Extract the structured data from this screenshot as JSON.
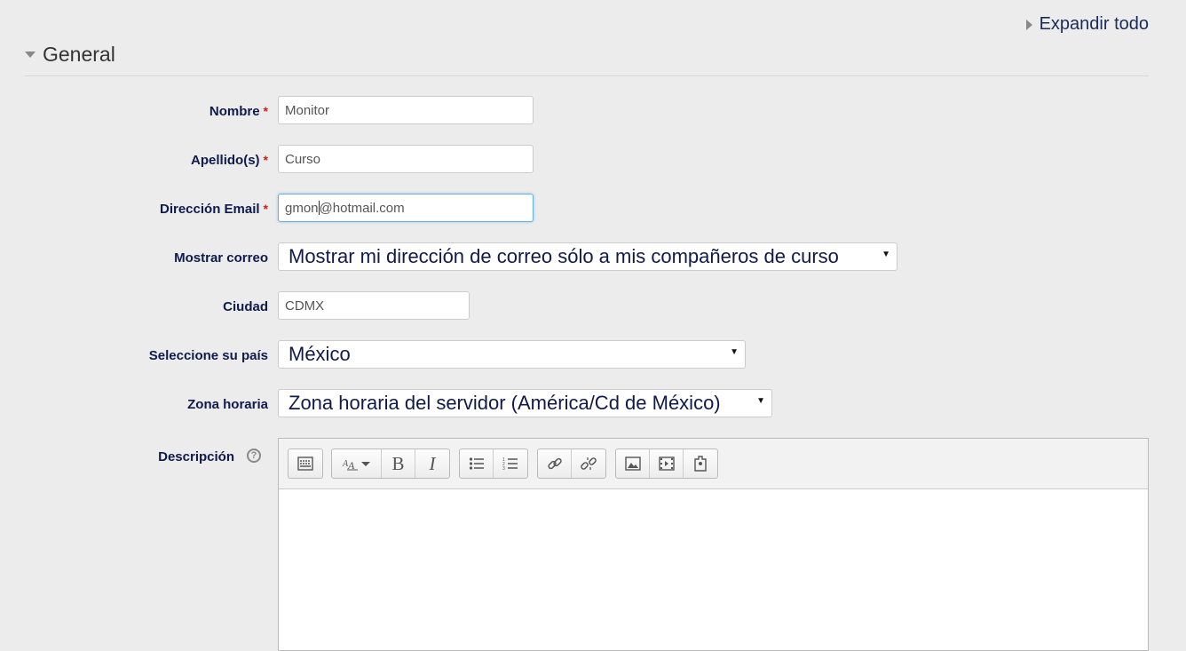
{
  "header": {
    "expand_all": "Expandir todo",
    "section_title": "General"
  },
  "fields": {
    "nombre": {
      "label": "Nombre",
      "required_mark": "*",
      "value": "Monitor"
    },
    "apellido": {
      "label": "Apellido(s)",
      "required_mark": "*",
      "value": "Curso"
    },
    "email": {
      "label": "Dirección Email",
      "required_mark": "*",
      "value_before_caret": "gmon",
      "value_after_caret": "@hotmail.com"
    },
    "mostrar_correo": {
      "label": "Mostrar correo",
      "selected": "Mostrar mi dirección de correo sólo a mis compañeros de curso"
    },
    "ciudad": {
      "label": "Ciudad",
      "value": "CDMX"
    },
    "pais": {
      "label": "Seleccione su país",
      "selected": "México"
    },
    "zona_horaria": {
      "label": "Zona horaria",
      "selected": "Zona horaria del servidor (América/Cd de México)"
    },
    "descripcion": {
      "label": "Descripción",
      "help_glyph": "?"
    }
  },
  "editor": {
    "toolbar_groups": [
      [
        "toolbar-toggle-icon"
      ],
      [
        "font-style-icon",
        "bold-icon",
        "italic-icon"
      ],
      [
        "unordered-list-icon",
        "ordered-list-icon"
      ],
      [
        "link-icon",
        "unlink-icon"
      ],
      [
        "image-icon",
        "media-icon",
        "manage-files-icon"
      ]
    ],
    "bold_glyph": "B",
    "italic_glyph": "I"
  },
  "colors": {
    "background": "#ececec",
    "label": "#0f1a4d",
    "required": "#d21b1b",
    "focus_border": "#66afe9"
  }
}
